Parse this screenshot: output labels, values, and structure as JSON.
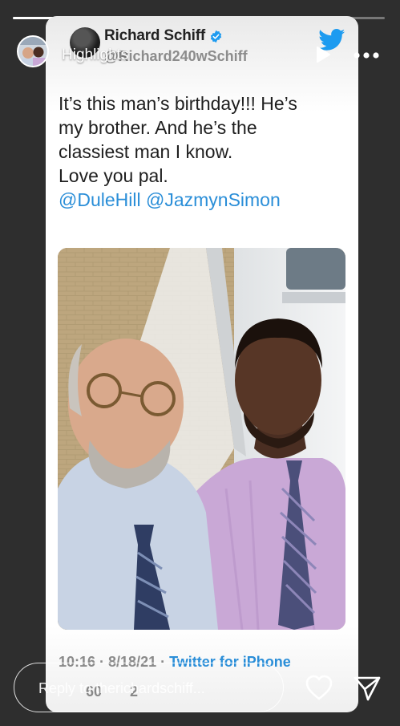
{
  "story": {
    "title": "Highlights",
    "progress": 0.55,
    "reply_placeholder": "Reply to therichardschiff..."
  },
  "tweet": {
    "display_name": "Richard Schiff",
    "handle": "@Richard240wSchiff",
    "text_lines": [
      "It’s this man’s birthday!!! He’s",
      "my brother. And he’s the",
      "classiest man I know.",
      "Love you pal."
    ],
    "mentions": "@DuleHill @JazmynSimon",
    "timestamp": "10:16 · 8/18/21 · ",
    "source": "Twitter for iPhone",
    "retweets": "60",
    "replies": "2"
  },
  "icons": {
    "verified": "verified-badge-icon",
    "twitter": "twitter-bird-icon",
    "play": "play-icon",
    "more": "more-horizontal-icon",
    "heart": "heart-icon",
    "send": "send-icon"
  },
  "colors": {
    "twitter_blue": "#1d9bf0",
    "link_blue": "#2a8ed8",
    "background": "#2e2e2e"
  }
}
